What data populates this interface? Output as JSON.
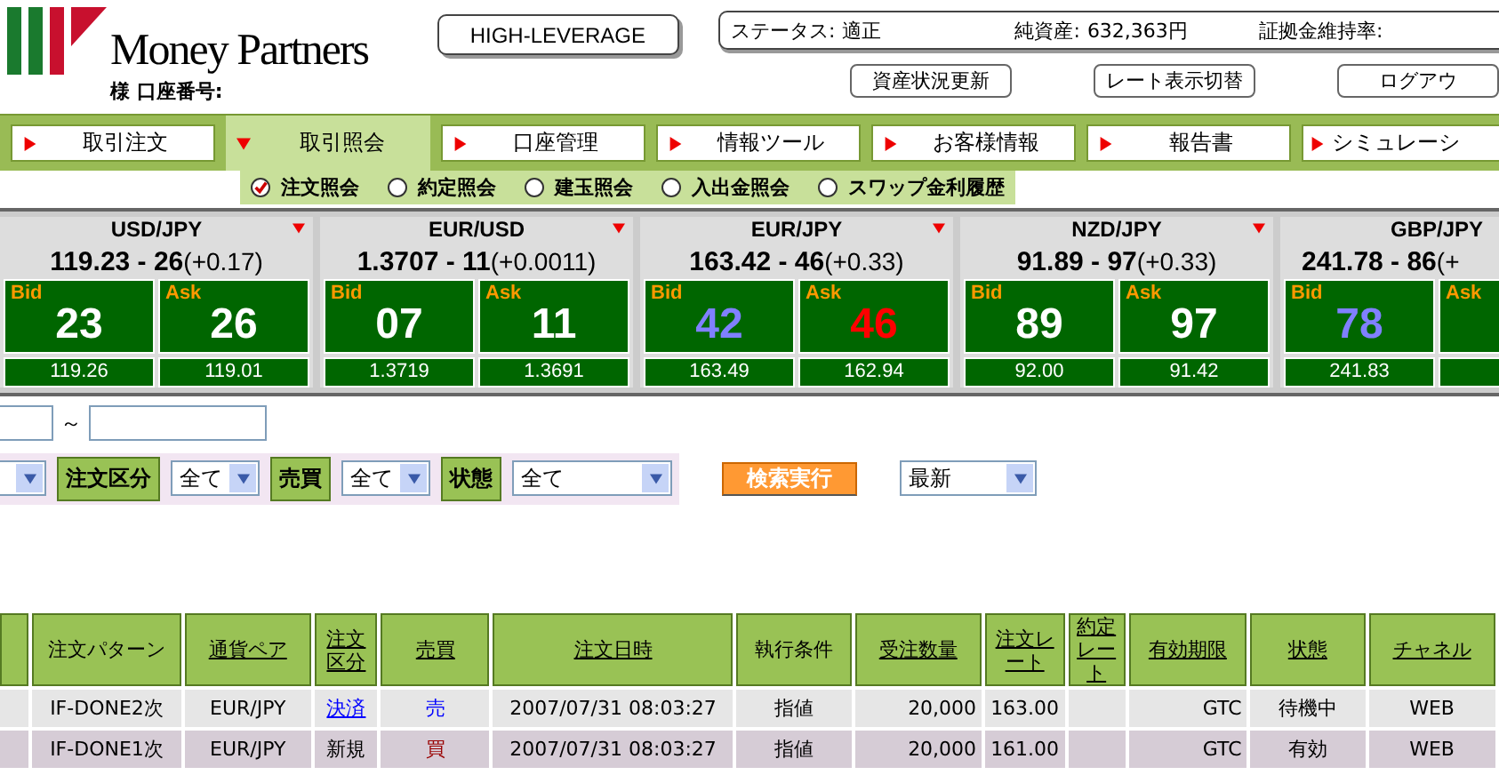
{
  "header": {
    "brand": "Money Partners",
    "account_label": "様 口座番号:",
    "mode_button": "HIGH-LEVERAGE",
    "status": [
      {
        "label": "ステータス:",
        "value": "適正"
      },
      {
        "label": "純資産:",
        "value": "632,363円"
      },
      {
        "label": "証拠金維持率:"
      }
    ],
    "buttons": [
      "資産状況更新",
      "レート表示切替",
      "ログアウ"
    ]
  },
  "nav": [
    {
      "label": "取引注文",
      "selected": false
    },
    {
      "label": "取引照会",
      "selected": true
    },
    {
      "label": "口座管理",
      "selected": false
    },
    {
      "label": "情報ツール",
      "selected": false
    },
    {
      "label": "お客様情報",
      "selected": false
    },
    {
      "label": "報告書",
      "selected": false
    },
    {
      "label": "シミュレーシ",
      "selected": false
    }
  ],
  "subnav": [
    {
      "label": "注文照会",
      "selected": true
    },
    {
      "label": "約定照会",
      "selected": false
    },
    {
      "label": "建玉照会",
      "selected": false
    },
    {
      "label": "入出金照会",
      "selected": false
    },
    {
      "label": "スワップ金利履歴",
      "selected": false
    }
  ],
  "rates": [
    {
      "pair": "USD/JPY",
      "quote": "119.23 - 26",
      "change": "(+0.17)",
      "bid": {
        "label": "Bid",
        "pips": "23",
        "price": "119.26"
      },
      "ask": {
        "label": "Ask",
        "pips": "26",
        "price": "119.01"
      }
    },
    {
      "pair": "EUR/USD",
      "quote": "1.3707 - 11",
      "change": "(+0.0011)",
      "bid": {
        "label": "Bid",
        "pips": "07",
        "price": "1.3719"
      },
      "ask": {
        "label": "Ask",
        "pips": "11",
        "price": "1.3691"
      }
    },
    {
      "pair": "EUR/JPY",
      "quote": "163.42 - 46",
      "change": "(+0.33)",
      "bid": {
        "label": "Bid",
        "pips": "42",
        "color": "#8080ff",
        "price": "163.49"
      },
      "ask": {
        "label": "Ask",
        "pips": "46",
        "color": "#ff0000",
        "price": "162.94"
      }
    },
    {
      "pair": "NZD/JPY",
      "quote": "91.89 - 97",
      "change": "(+0.33)",
      "bid": {
        "label": "Bid",
        "pips": "89",
        "price": "92.00"
      },
      "ask": {
        "label": "Ask",
        "pips": "97",
        "price": "91.42"
      }
    },
    {
      "pair": "GBP/JPY",
      "quote": "241.78 - 86",
      "change": "(+",
      "bid": {
        "label": "Bid",
        "pips": "78",
        "color": "#8080ff",
        "price": "241.83"
      },
      "ask": {
        "label": "Ask"
      }
    }
  ],
  "date_range": {
    "separator": "～"
  },
  "filters": [
    {
      "kind": "select"
    },
    {
      "kind": "label",
      "text": "注文区分"
    },
    {
      "kind": "select",
      "value": "全て"
    },
    {
      "kind": "label",
      "text": "売買"
    },
    {
      "kind": "select",
      "value": "全て"
    },
    {
      "kind": "label",
      "text": "状態"
    },
    {
      "kind": "wide-select",
      "value": "全て"
    }
  ],
  "search_button": "検索実行",
  "sort_select": "最新",
  "table": {
    "columns": [
      {
        "label": "注文パターン",
        "sortable": false
      },
      {
        "label": "通貨ペア",
        "sortable": true
      },
      {
        "label": "注文区分",
        "sortable": true
      },
      {
        "label": "売買",
        "sortable": true
      },
      {
        "label": "注文日時",
        "sortable": true
      },
      {
        "label": "執行条件",
        "sortable": false
      },
      {
        "label": "受注数量",
        "sortable": true
      },
      {
        "label": "注文レート",
        "sortable": true
      },
      {
        "label": "約定レート",
        "sortable": true
      },
      {
        "label": "有効期限",
        "sortable": true
      },
      {
        "label": "状態",
        "sortable": true
      },
      {
        "label": "チャネル",
        "sortable": true
      }
    ],
    "rows": [
      {
        "pattern": "IF-DONE2次",
        "pair": "EUR/JPY",
        "type": {
          "text": "決済",
          "link": true
        },
        "side": {
          "text": "売",
          "color": "#0000ff"
        },
        "time": "2007/07/31 08:03:27",
        "condition": "指値",
        "quantity": "20,000",
        "order_rate": "163.00",
        "fill_rate": "",
        "expiry": "GTC",
        "status": "待機中",
        "channel": "WEB"
      },
      {
        "pattern": "IF-DONE1次",
        "pair": "EUR/JPY",
        "type": {
          "text": "新規",
          "link": false
        },
        "side": {
          "text": "買",
          "color": "#990000"
        },
        "time": "2007/07/31 08:03:27",
        "condition": "指値",
        "quantity": "20,000",
        "order_rate": "161.00",
        "fill_rate": "",
        "expiry": "GTC",
        "status": "有効",
        "channel": "WEB"
      }
    ]
  }
}
